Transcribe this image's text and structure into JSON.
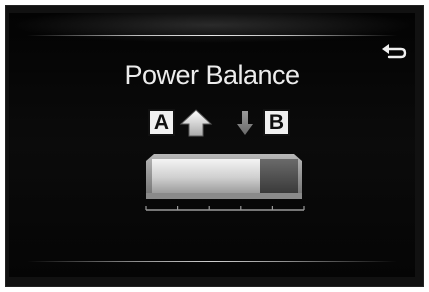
{
  "screen": {
    "title": "Power Balance",
    "back_icon": "return-arrow-icon"
  },
  "balance": {
    "label_a": "A",
    "label_b": "B",
    "increase_icon": "arrow-up-icon",
    "decrease_icon": "arrow-down-icon",
    "level_fraction": 0.74,
    "scale_divisions": 5
  },
  "colors": {
    "background": "#050505",
    "text": "#ececec",
    "bar_light": "#cfcfcf",
    "bar_dark": "#4a4a4a"
  }
}
